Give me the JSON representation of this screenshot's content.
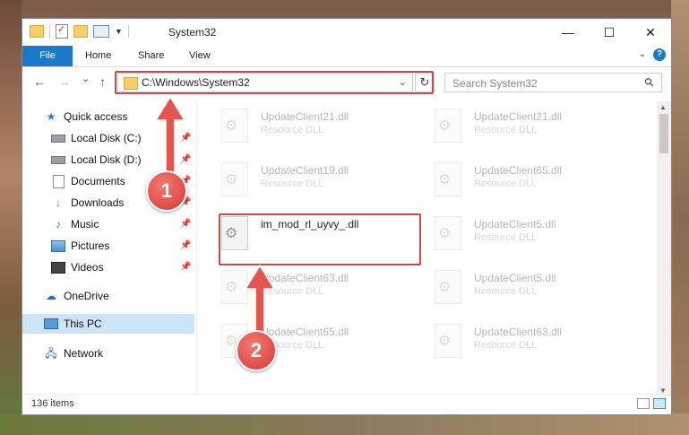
{
  "window": {
    "title": "System32",
    "controls": {
      "minimize": "—",
      "maximize": "☐",
      "close": "✕"
    }
  },
  "ribbon": {
    "tabs": [
      {
        "label": "File",
        "active": true
      },
      {
        "label": "Home"
      },
      {
        "label": "Share"
      },
      {
        "label": "View"
      }
    ],
    "help_label": "?"
  },
  "navigation": {
    "back": "←",
    "forward": "→",
    "recent": "⌄",
    "up": "↑",
    "address": "C:\\Windows\\System32",
    "refresh": "↻",
    "search_placeholder": "Search System32"
  },
  "sidebar": {
    "items": [
      {
        "label": "Quick access",
        "icon": "star-icon",
        "pinned": false
      },
      {
        "label": "Local Disk (C:)",
        "icon": "drive-icon",
        "pinned": true
      },
      {
        "label": "Local Disk (D:)",
        "icon": "drive-icon",
        "pinned": true
      },
      {
        "label": "Documents",
        "icon": "documents-icon",
        "pinned": true
      },
      {
        "label": "Downloads",
        "icon": "downloads-icon",
        "pinned": true
      },
      {
        "label": "Music",
        "icon": "music-icon",
        "pinned": true
      },
      {
        "label": "Pictures",
        "icon": "pictures-icon",
        "pinned": true
      },
      {
        "label": "Videos",
        "icon": "videos-icon",
        "pinned": true
      },
      {
        "label": "OneDrive",
        "icon": "cloud-icon",
        "pinned": false
      },
      {
        "label": "This PC",
        "icon": "computer-icon",
        "pinned": false,
        "selected": true
      },
      {
        "label": "Network",
        "icon": "network-icon",
        "pinned": false
      }
    ]
  },
  "files": [
    {
      "name": "UpdateClient21.dll",
      "type": "Resource DLL",
      "faded": true
    },
    {
      "name": "UpdateClient21.dll",
      "type": "Resource DLL",
      "faded": true
    },
    {
      "name": "UpdateClient19.dll",
      "type": "Resource DLL",
      "faded": true
    },
    {
      "name": "UpdateClient65.dll",
      "type": "Resource DLL",
      "faded": true
    },
    {
      "name": "im_mod_rl_uyvy_.dll",
      "type": "",
      "faded": false,
      "highlighted": true
    },
    {
      "name": "UpdateClient5.dll",
      "type": "Resource DLL",
      "faded": true
    },
    {
      "name": "UpdateClient63.dll",
      "type": "Resource DLL",
      "faded": true
    },
    {
      "name": "UpdateClient5.dll",
      "type": "Resource DLL",
      "faded": true
    },
    {
      "name": "UpdateClient65.dll",
      "type": "Resource DLL",
      "faded": true
    },
    {
      "name": "UpdateClient63.dll",
      "type": "Resource DLL",
      "faded": true
    }
  ],
  "status": {
    "item_count": "136 items"
  },
  "annotations": [
    {
      "number": "1",
      "color": "#e5554f"
    },
    {
      "number": "2",
      "color": "#e5554f"
    }
  ]
}
